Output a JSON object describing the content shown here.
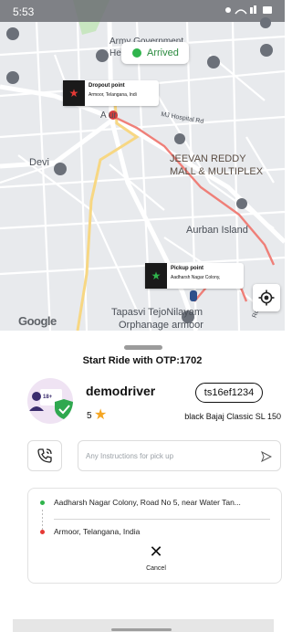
{
  "status_bar": {
    "time": "5:53",
    "left_icons": [
      "gallery-icon",
      "whatsapp-icon",
      "youtube-icon"
    ],
    "battery": "97"
  },
  "map": {
    "labels": {
      "army_govt": "Army Government",
      "army_govt_2": "He",
      "armoor": "A    ur",
      "mj_hospital": "MJ Hospital Rd",
      "devi": "Devi",
      "jeevan_1": "JEEVAN REDDY",
      "jeevan_2": "MALL & MULTIPLEX",
      "aurban": "Aurban Island",
      "tapasvi_1": "Tapasvi TejoNilayam",
      "tapasvi_2": "Orphanage armoor",
      "rd": "Rd"
    },
    "arrived_label": "Arrived",
    "dropout_marker": {
      "title": "Dropout point",
      "subtitle": "Armoor, Telangana, Indi"
    },
    "pickup_marker": {
      "title": "Pickup point",
      "subtitle": "Aadharsh Nagar Colony,"
    },
    "google_logo": "Google"
  },
  "sheet": {
    "otp_text": "Start Ride with OTP:1702",
    "avatar_badge": "18+",
    "driver_name": "demodriver",
    "vehicle_number": "ts16ef1234",
    "rating": "5",
    "vehicle_model": "black Bajaj Classic SL 150",
    "instructions_placeholder": "Any Instructions for pick up",
    "pickup_address": "Aadharsh Nagar Colony, Road No 5, near Water Tan...",
    "drop_address": "Armoor, Telangana, India",
    "cancel_label": "Cancel"
  },
  "colors": {
    "pickup_dot": "#2fb44c",
    "drop_dot": "#e53935",
    "route": "#ef7f78",
    "rating_star": "#f5a623",
    "badge_green": "#2fa84f"
  }
}
